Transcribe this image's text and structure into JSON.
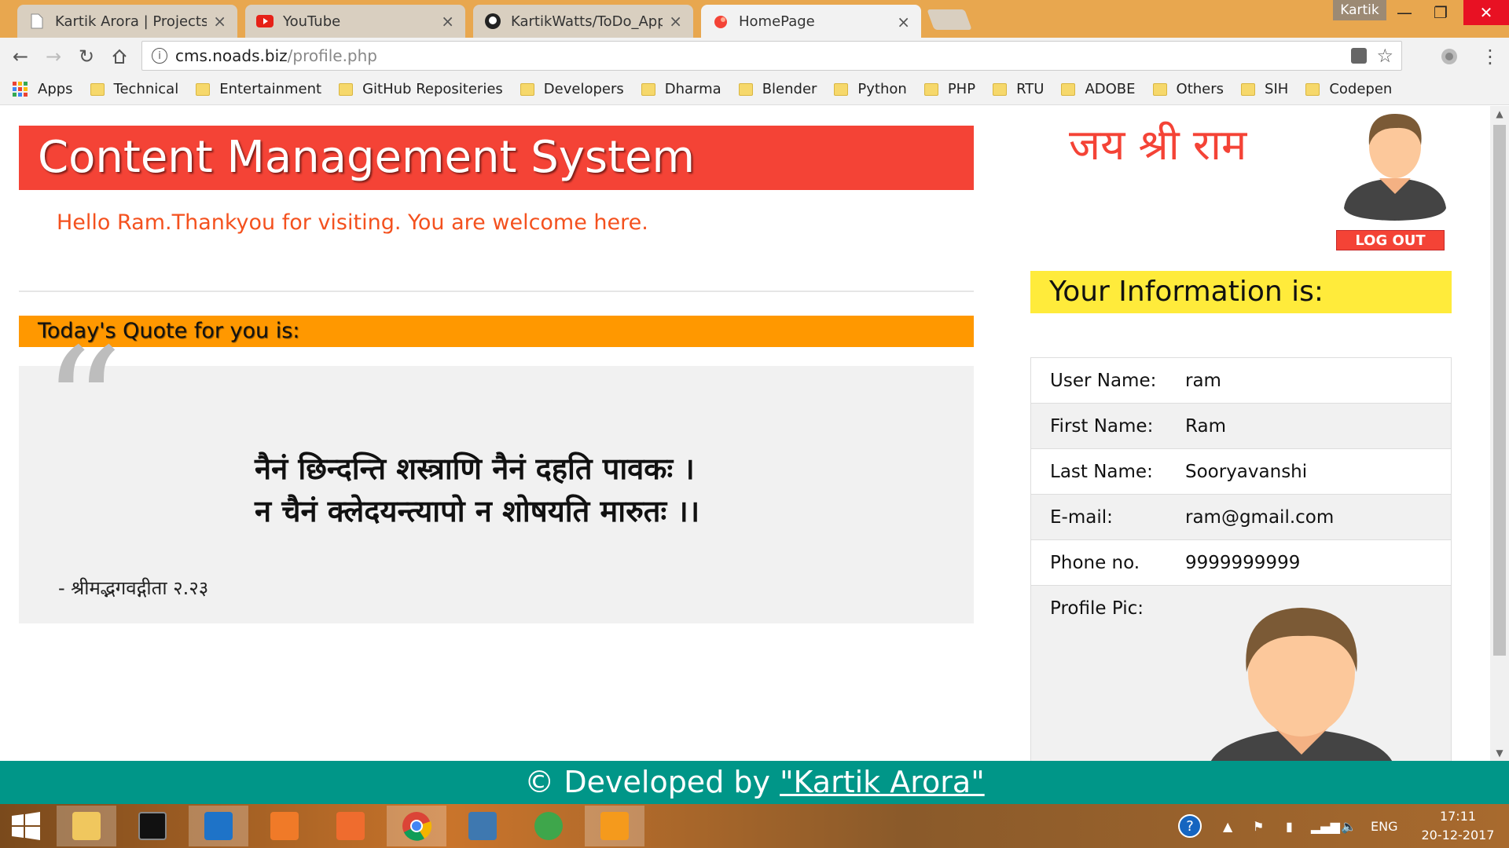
{
  "browser": {
    "tabs": [
      {
        "label": "Kartik Arora | Projects",
        "active": false
      },
      {
        "label": "YouTube",
        "active": false
      },
      {
        "label": "KartikWatts/ToDo_App: /",
        "active": false
      },
      {
        "label": "HomePage",
        "active": true
      }
    ],
    "profile_name": "Kartik",
    "url_host": "cms.noads.biz",
    "url_path": "/profile.php",
    "bookmarks": [
      "Apps",
      "Technical",
      "Entertainment",
      "GitHub Repositeries",
      "Developers",
      "Dharma",
      "Blender",
      "Python",
      "PHP",
      "RTU",
      "ADOBE",
      "Others",
      "SIH",
      "Codepen"
    ]
  },
  "page": {
    "header_title": "Content Management System",
    "greeting": "Hello Ram.Thankyou for visiting. You are welcome here.",
    "quote_heading": "Today's Quote for you is:",
    "quote_mark": "“",
    "quote_line1": "नैनं छिन्दन्ति शस्त्राणि नैनं दहति पावकः ।",
    "quote_line2": "न चैनं क्लेदयन्त्यापो न शोषयति मारुतः ।।",
    "quote_source": "- श्रीमद्भगवद्गीता २.२३",
    "jai_shri_ram": "जय श्री राम",
    "logout_label": "LOG OUT",
    "info_heading": "Your Information is:",
    "info": [
      {
        "key": "User Name:",
        "value": "ram"
      },
      {
        "key": "First Name:",
        "value": "Ram"
      },
      {
        "key": "Last Name:",
        "value": "Sooryavanshi"
      },
      {
        "key": "E-mail:",
        "value": "ram@gmail.com"
      },
      {
        "key": "Phone no.",
        "value": "9999999999"
      }
    ],
    "profile_pic_label": "Profile Pic:",
    "footer_prefix": "© Developed by ",
    "footer_link": "\"Kartik Arora\""
  },
  "taskbar": {
    "language": "ENG",
    "time": "17:11",
    "date": "20-12-2017"
  },
  "colors": {
    "header_red": "#f44336",
    "quote_orange": "#ff9800",
    "info_yellow": "#ffeb3b",
    "footer_teal": "#009688"
  }
}
